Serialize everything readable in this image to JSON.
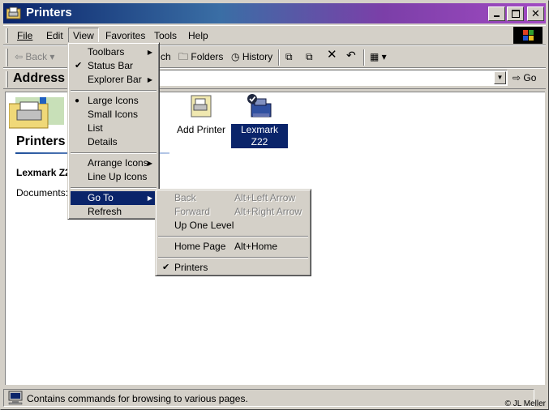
{
  "window": {
    "title": "Printers"
  },
  "menubar": {
    "items": [
      "File",
      "Edit",
      "View",
      "Favorites",
      "Tools",
      "Help"
    ]
  },
  "toolbar": {
    "back": "Back",
    "search_partial": "ch",
    "folders": "Folders",
    "history": "History"
  },
  "addressbar": {
    "label": "Address",
    "value": "",
    "go": "Go"
  },
  "folder_pane": {
    "title": "Printers",
    "selected_name": "Lexmark Z2",
    "documents_label": "Documents: 0"
  },
  "icons": [
    {
      "label": "Add Printer",
      "selected": false
    },
    {
      "label": "Lexmark Z22",
      "selected": true
    }
  ],
  "view_menu": {
    "items": [
      {
        "label": "Toolbars",
        "submenu": true
      },
      {
        "label": "Status Bar",
        "checked": true
      },
      {
        "label": "Explorer Bar",
        "submenu": true
      },
      {
        "label": "Large Icons",
        "radio": true
      },
      {
        "label": "Small Icons"
      },
      {
        "label": "List"
      },
      {
        "label": "Details"
      },
      {
        "label": "Arrange Icons",
        "submenu": true
      },
      {
        "label": "Line Up Icons"
      },
      {
        "label": "Go To",
        "submenu": true,
        "highlighted": true
      },
      {
        "label": "Refresh"
      }
    ]
  },
  "goto_menu": {
    "items": [
      {
        "label": "Back",
        "accel": "Alt+Left Arrow",
        "disabled": true
      },
      {
        "label": "Forward",
        "accel": "Alt+Right Arrow",
        "disabled": true
      },
      {
        "label": "Up One Level",
        "accel": ""
      },
      {
        "label": "Home Page",
        "accel": "Alt+Home"
      },
      {
        "label": "Printers",
        "checked": true
      }
    ]
  },
  "statusbar": {
    "text": "Contains commands for browsing to various pages."
  },
  "credit": "© JL Meller",
  "colors": {
    "highlight": "#0a246a",
    "face": "#d4d0c8",
    "title_start": "#0a246a",
    "title_end": "#a24ac2"
  }
}
